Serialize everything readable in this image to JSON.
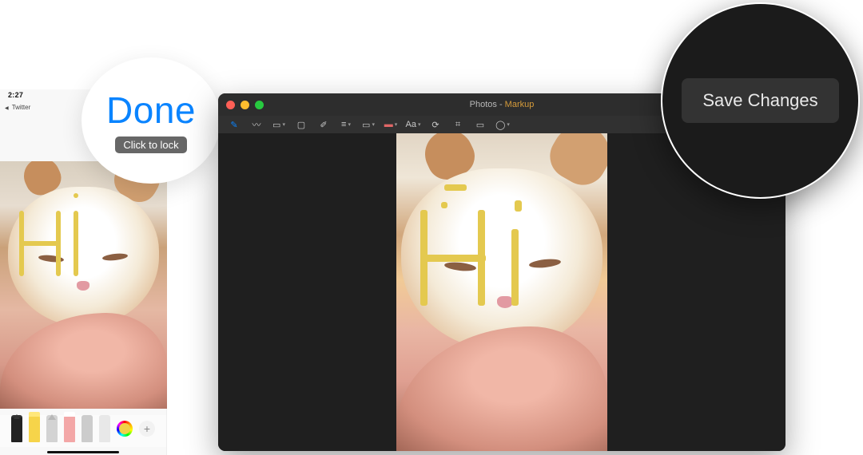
{
  "iphone": {
    "status_time": "2:27",
    "breadcrumb": "Twitter",
    "tools": [
      {
        "name": "pen-tool"
      },
      {
        "name": "highlighter-tool"
      },
      {
        "name": "pencil-tool"
      },
      {
        "name": "eraser-tool"
      },
      {
        "name": "lasso-tool"
      },
      {
        "name": "ruler-tool"
      }
    ],
    "add_label": "+"
  },
  "done_callout": {
    "label": "Done",
    "hint": "Click to lock"
  },
  "mac_window": {
    "title_app": "Photos",
    "title_sep": " - ",
    "title_mode": "Markup",
    "toolbar_icons": [
      {
        "name": "sketch-icon",
        "active": true,
        "dropdown": false
      },
      {
        "name": "draw-icon",
        "dropdown": false
      },
      {
        "name": "shapes-icon",
        "dropdown": true
      },
      {
        "name": "text-icon",
        "dropdown": false
      },
      {
        "name": "sign-icon",
        "dropdown": false
      },
      {
        "name": "shape-style-icon",
        "dropdown": true
      },
      {
        "name": "border-color-icon",
        "dropdown": true
      },
      {
        "name": "fill-color-icon",
        "dropdown": true
      },
      {
        "name": "text-style-icon",
        "dropdown": true
      },
      {
        "name": "rotate-icon",
        "dropdown": false
      },
      {
        "name": "crop-icon",
        "dropdown": false
      },
      {
        "name": "describe-icon",
        "dropdown": false
      },
      {
        "name": "annotate-icon",
        "dropdown": true
      }
    ]
  },
  "save_callout": {
    "label": "Save Changes"
  },
  "annotation_text": "Hi"
}
